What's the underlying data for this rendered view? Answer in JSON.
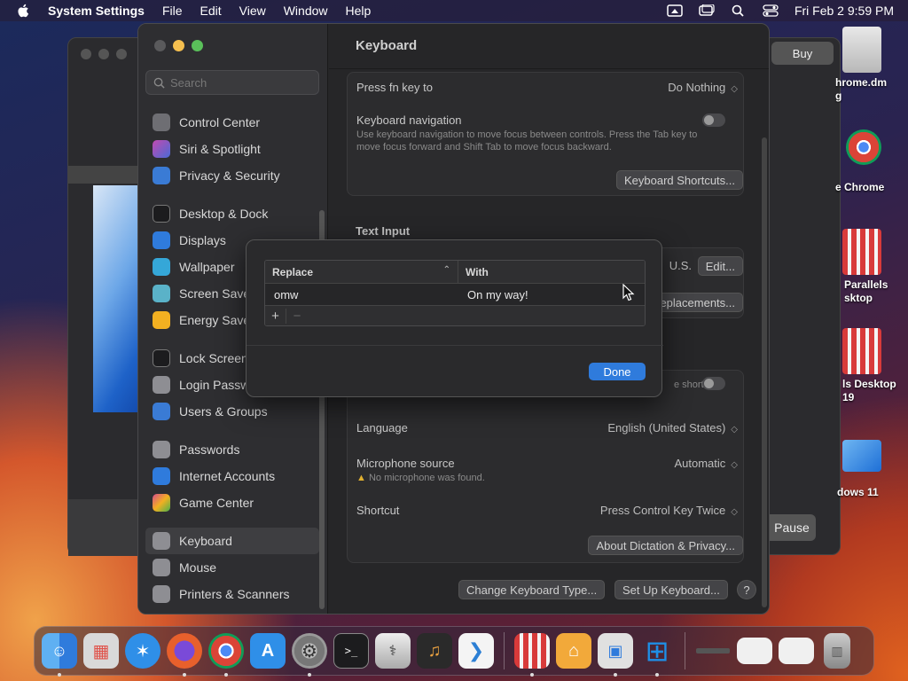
{
  "menubar": {
    "app_name": "System Settings",
    "menus": [
      "File",
      "Edit",
      "View",
      "Window",
      "Help"
    ],
    "clock": "Fri Feb 2  9:59 PM"
  },
  "background_window": {
    "buy_label": "Buy",
    "pause_label": "Pause"
  },
  "desktop_icons": [
    {
      "label": "hrome.dm\ng"
    },
    {
      "label": "e Chrome"
    },
    {
      "label": "Parallels\nsktop"
    },
    {
      "label": "ls Desktop\n19"
    },
    {
      "label": "dows 11"
    }
  ],
  "sidebar": {
    "search_placeholder": "Search",
    "items": [
      {
        "label": "Control Center",
        "color": "#6e6e73"
      },
      {
        "label": "Siri & Spotlight",
        "color": "#c24ab0"
      },
      {
        "label": "Privacy & Security",
        "color": "#3a7bd5"
      },
      {
        "label": "Desktop & Dock",
        "color": "#1c1c1e"
      },
      {
        "label": "Displays",
        "color": "#2f7bdc"
      },
      {
        "label": "Wallpaper",
        "color": "#35a7d8"
      },
      {
        "label": "Screen Saver",
        "color": "#5ab2c8"
      },
      {
        "label": "Energy Saver",
        "color": "#f2b021"
      },
      {
        "label": "Lock Screen",
        "color": "#1c1c1e"
      },
      {
        "label": "Login Password",
        "color": "#8e8e93"
      },
      {
        "label": "Users & Groups",
        "color": "#3a7bd5"
      },
      {
        "label": "Passwords",
        "color": "#8e8e93"
      },
      {
        "label": "Internet Accounts",
        "color": "#2f7bdc"
      },
      {
        "label": "Game Center",
        "color": "#d84c8c"
      },
      {
        "label": "Keyboard",
        "color": "#8e8e93"
      },
      {
        "label": "Mouse",
        "color": "#8e8e93"
      },
      {
        "label": "Printers & Scanners",
        "color": "#8e8e93"
      }
    ],
    "active": "Keyboard"
  },
  "content": {
    "title": "Keyboard",
    "fn_label": "Press fn key to",
    "fn_value": "Do Nothing",
    "nav_label": "Keyboard navigation",
    "nav_desc": "Use keyboard navigation to move focus between controls. Press the Tab key to move focus forward and Shift Tab to move focus backward.",
    "shortcuts_button": "Keyboard Shortcuts...",
    "text_input_title": "Text Input",
    "input_source_value": "U.S.",
    "edit_button": "Edit...",
    "replacements_button": "eplacements...",
    "dictation_shortcut_partial": "e shortcut",
    "language_label": "Language",
    "language_value": "English (United States)",
    "mic_label": "Microphone source",
    "mic_value": "Automatic",
    "mic_warning": "No microphone was found.",
    "shortcut_label": "Shortcut",
    "shortcut_value": "Press Control Key Twice",
    "about_button": "About Dictation & Privacy...",
    "change_type_button": "Change Keyboard Type...",
    "setup_button": "Set Up Keyboard...",
    "help_label": "?"
  },
  "sheet": {
    "col_replace": "Replace",
    "col_with": "With",
    "rows": [
      {
        "replace": "omw",
        "with": "On my way!"
      }
    ],
    "add_label": "+",
    "remove_label": "−",
    "done_label": "Done"
  },
  "dock": {
    "apps": [
      {
        "name": "finder",
        "color": "#3a8ee6"
      },
      {
        "name": "launchpad",
        "color": "#d9d9d9"
      },
      {
        "name": "safari",
        "color": "#2f8fe8"
      },
      {
        "name": "firefox",
        "color": "#e8602c"
      },
      {
        "name": "chrome",
        "color": "#f2f2f2"
      },
      {
        "name": "app-store",
        "color": "#2f8fe8"
      },
      {
        "name": "system-settings",
        "color": "#8e8e93"
      },
      {
        "name": "terminal",
        "color": "#1c1c1e"
      },
      {
        "name": "disk-utility",
        "color": "#c8c8c8"
      },
      {
        "name": "garageband",
        "color": "#2a2a2a"
      },
      {
        "name": "vscode",
        "color": "#2c7fd4"
      },
      {
        "name": "parallels",
        "color": "#d83a3a"
      },
      {
        "name": "home",
        "color": "#f2a93a"
      },
      {
        "name": "parallels-desktop",
        "color": "#e0e0e0"
      },
      {
        "name": "windows",
        "color": "#1e6fd6"
      },
      {
        "name": "window-thumb-1",
        "color": "#555555"
      },
      {
        "name": "window-thumb-2",
        "color": "#f0f0f0"
      },
      {
        "name": "window-thumb-3",
        "color": "#f0f0f0"
      },
      {
        "name": "trash",
        "color": "#9a9a9a"
      }
    ]
  }
}
